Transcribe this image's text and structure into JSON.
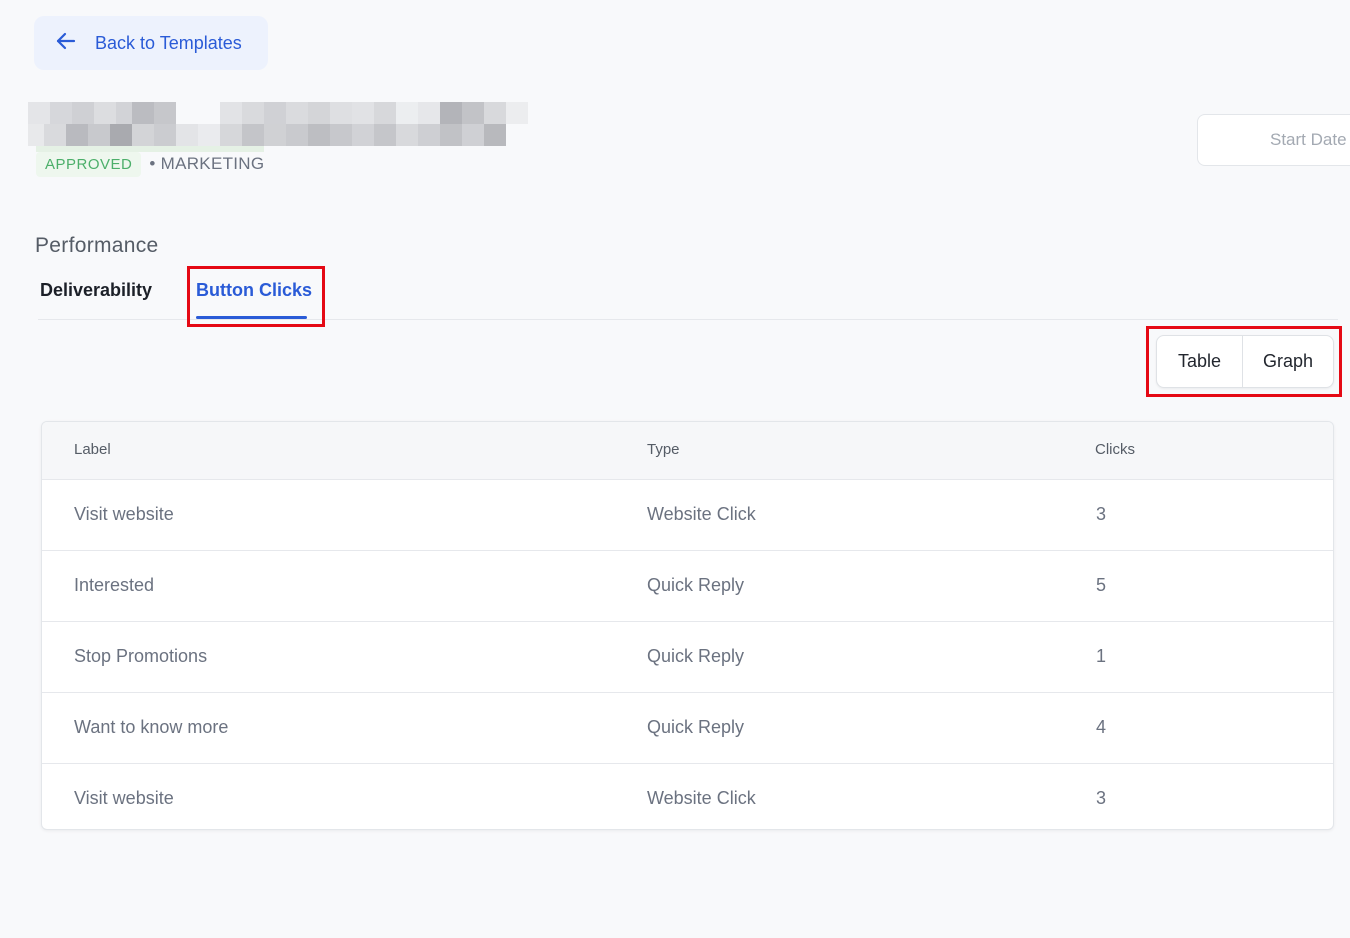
{
  "back_button": {
    "label": "Back to Templates",
    "icon": "arrow-left-icon"
  },
  "template": {
    "status": "APPROVED",
    "category": "• MARKETING"
  },
  "date_filter": {
    "placeholder": "Start Date"
  },
  "performance": {
    "title": "Performance",
    "tabs": [
      {
        "label": "Deliverability",
        "active": false
      },
      {
        "label": "Button Clicks",
        "active": true
      }
    ]
  },
  "view_toggle": {
    "table_label": "Table",
    "graph_label": "Graph"
  },
  "table": {
    "columns": [
      "Label",
      "Type",
      "Clicks"
    ],
    "rows": [
      {
        "label": "Visit website",
        "type": "Website Click",
        "clicks": "3"
      },
      {
        "label": "Interested",
        "type": "Quick Reply",
        "clicks": "5"
      },
      {
        "label": "Stop Promotions",
        "type": "Quick Reply",
        "clicks": "1"
      },
      {
        "label": "Want to know more",
        "type": "Quick Reply",
        "clicks": "4"
      },
      {
        "label": "Visit website",
        "type": "Website Click",
        "clicks": "3"
      }
    ]
  },
  "colors": {
    "accent": "#2a5bd7",
    "approved": "#4caf6a",
    "highlight": "#e50914",
    "background": "#f8f9fb"
  }
}
